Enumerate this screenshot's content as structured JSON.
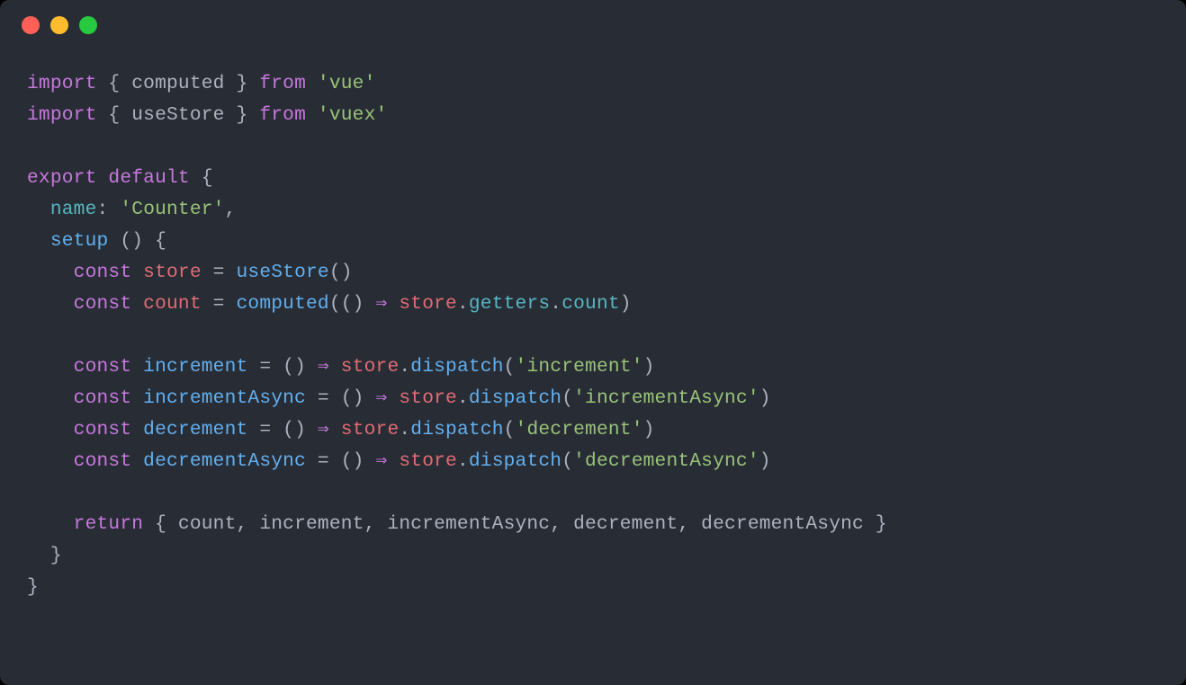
{
  "titlebar": {
    "buttons": [
      "close",
      "minimize",
      "zoom"
    ]
  },
  "code": {
    "lines": [
      [
        {
          "t": "import",
          "c": "keyword"
        },
        {
          "t": " { ",
          "c": "punct"
        },
        {
          "t": "computed",
          "c": "ident"
        },
        {
          "t": " } ",
          "c": "punct"
        },
        {
          "t": "from",
          "c": "keyword"
        },
        {
          "t": " ",
          "c": "punct"
        },
        {
          "t": "'vue'",
          "c": "string"
        }
      ],
      [
        {
          "t": "import",
          "c": "keyword"
        },
        {
          "t": " { ",
          "c": "punct"
        },
        {
          "t": "useStore",
          "c": "ident"
        },
        {
          "t": " } ",
          "c": "punct"
        },
        {
          "t": "from",
          "c": "keyword"
        },
        {
          "t": " ",
          "c": "punct"
        },
        {
          "t": "'vuex'",
          "c": "string"
        }
      ],
      [],
      [
        {
          "t": "export",
          "c": "keyword"
        },
        {
          "t": " ",
          "c": "punct"
        },
        {
          "t": "default",
          "c": "keyword"
        },
        {
          "t": " {",
          "c": "punct"
        }
      ],
      [
        {
          "t": "  ",
          "c": "punct"
        },
        {
          "t": "name",
          "c": "prop"
        },
        {
          "t": ": ",
          "c": "punct"
        },
        {
          "t": "'Counter'",
          "c": "string"
        },
        {
          "t": ",",
          "c": "punct"
        }
      ],
      [
        {
          "t": "  ",
          "c": "punct"
        },
        {
          "t": "setup",
          "c": "func"
        },
        {
          "t": " () {",
          "c": "punct"
        }
      ],
      [
        {
          "t": "    ",
          "c": "punct"
        },
        {
          "t": "const",
          "c": "keyword"
        },
        {
          "t": " ",
          "c": "punct"
        },
        {
          "t": "store",
          "c": "var"
        },
        {
          "t": " = ",
          "c": "punct"
        },
        {
          "t": "useStore",
          "c": "func"
        },
        {
          "t": "()",
          "c": "punct"
        }
      ],
      [
        {
          "t": "    ",
          "c": "punct"
        },
        {
          "t": "const",
          "c": "keyword"
        },
        {
          "t": " ",
          "c": "punct"
        },
        {
          "t": "count",
          "c": "var"
        },
        {
          "t": " = ",
          "c": "punct"
        },
        {
          "t": "computed",
          "c": "func"
        },
        {
          "t": "(() ",
          "c": "punct"
        },
        {
          "t": "⇒",
          "c": "arrow"
        },
        {
          "t": " ",
          "c": "punct"
        },
        {
          "t": "store",
          "c": "var"
        },
        {
          "t": ".",
          "c": "punct"
        },
        {
          "t": "getters",
          "c": "prop"
        },
        {
          "t": ".",
          "c": "punct"
        },
        {
          "t": "count",
          "c": "prop"
        },
        {
          "t": ")",
          "c": "punct"
        }
      ],
      [],
      [
        {
          "t": "    ",
          "c": "punct"
        },
        {
          "t": "const",
          "c": "keyword"
        },
        {
          "t": " ",
          "c": "punct"
        },
        {
          "t": "increment",
          "c": "func"
        },
        {
          "t": " = () ",
          "c": "punct"
        },
        {
          "t": "⇒",
          "c": "arrow"
        },
        {
          "t": " ",
          "c": "punct"
        },
        {
          "t": "store",
          "c": "var"
        },
        {
          "t": ".",
          "c": "punct"
        },
        {
          "t": "dispatch",
          "c": "func"
        },
        {
          "t": "(",
          "c": "punct"
        },
        {
          "t": "'increment'",
          "c": "string"
        },
        {
          "t": ")",
          "c": "punct"
        }
      ],
      [
        {
          "t": "    ",
          "c": "punct"
        },
        {
          "t": "const",
          "c": "keyword"
        },
        {
          "t": " ",
          "c": "punct"
        },
        {
          "t": "incrementAsync",
          "c": "func"
        },
        {
          "t": " = () ",
          "c": "punct"
        },
        {
          "t": "⇒",
          "c": "arrow"
        },
        {
          "t": " ",
          "c": "punct"
        },
        {
          "t": "store",
          "c": "var"
        },
        {
          "t": ".",
          "c": "punct"
        },
        {
          "t": "dispatch",
          "c": "func"
        },
        {
          "t": "(",
          "c": "punct"
        },
        {
          "t": "'incrementAsync'",
          "c": "string"
        },
        {
          "t": ")",
          "c": "punct"
        }
      ],
      [
        {
          "t": "    ",
          "c": "punct"
        },
        {
          "t": "const",
          "c": "keyword"
        },
        {
          "t": " ",
          "c": "punct"
        },
        {
          "t": "decrement",
          "c": "func"
        },
        {
          "t": " = () ",
          "c": "punct"
        },
        {
          "t": "⇒",
          "c": "arrow"
        },
        {
          "t": " ",
          "c": "punct"
        },
        {
          "t": "store",
          "c": "var"
        },
        {
          "t": ".",
          "c": "punct"
        },
        {
          "t": "dispatch",
          "c": "func"
        },
        {
          "t": "(",
          "c": "punct"
        },
        {
          "t": "'decrement'",
          "c": "string"
        },
        {
          "t": ")",
          "c": "punct"
        }
      ],
      [
        {
          "t": "    ",
          "c": "punct"
        },
        {
          "t": "const",
          "c": "keyword"
        },
        {
          "t": " ",
          "c": "punct"
        },
        {
          "t": "decrementAsync",
          "c": "func"
        },
        {
          "t": " = () ",
          "c": "punct"
        },
        {
          "t": "⇒",
          "c": "arrow"
        },
        {
          "t": " ",
          "c": "punct"
        },
        {
          "t": "store",
          "c": "var"
        },
        {
          "t": ".",
          "c": "punct"
        },
        {
          "t": "dispatch",
          "c": "func"
        },
        {
          "t": "(",
          "c": "punct"
        },
        {
          "t": "'decrementAsync'",
          "c": "string"
        },
        {
          "t": ")",
          "c": "punct"
        }
      ],
      [],
      [
        {
          "t": "    ",
          "c": "punct"
        },
        {
          "t": "return",
          "c": "keyword"
        },
        {
          "t": " { ",
          "c": "punct"
        },
        {
          "t": "count",
          "c": "ident"
        },
        {
          "t": ", ",
          "c": "punct"
        },
        {
          "t": "increment",
          "c": "ident"
        },
        {
          "t": ", ",
          "c": "punct"
        },
        {
          "t": "incrementAsync",
          "c": "ident"
        },
        {
          "t": ", ",
          "c": "punct"
        },
        {
          "t": "decrement",
          "c": "ident"
        },
        {
          "t": ", ",
          "c": "punct"
        },
        {
          "t": "decrementAsync",
          "c": "ident"
        },
        {
          "t": " }",
          "c": "punct"
        }
      ],
      [
        {
          "t": "  }",
          "c": "punct"
        }
      ],
      [
        {
          "t": "}",
          "c": "punct"
        }
      ]
    ]
  }
}
